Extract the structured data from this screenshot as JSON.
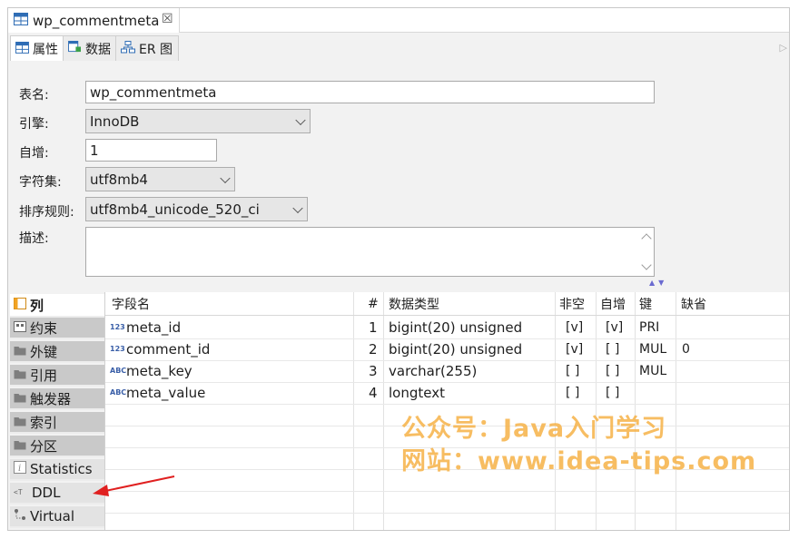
{
  "editor_tab": {
    "title": "wp_commentmeta",
    "close": "☒"
  },
  "sub_tabs": [
    {
      "label": "属性"
    },
    {
      "label": "数据"
    },
    {
      "label": "ER 图"
    }
  ],
  "properties": {
    "table_name_label": "表名:",
    "table_name_value": "wp_commentmeta",
    "engine_label": "引擎:",
    "engine_value": "InnoDB",
    "auto_inc_label": "自增:",
    "auto_inc_value": "1",
    "charset_label": "字符集:",
    "charset_value": "utf8mb4",
    "collation_label": "排序规则:",
    "collation_value": "utf8mb4_unicode_520_ci",
    "desc_label": "描述:",
    "desc_value": ""
  },
  "side_tabs": [
    {
      "label": "列",
      "icon": "columns-icon"
    },
    {
      "label": "约束",
      "icon": "constraint-icon"
    },
    {
      "label": "外键",
      "icon": "folder-icon"
    },
    {
      "label": "引用",
      "icon": "folder-icon"
    },
    {
      "label": "触发器",
      "icon": "folder-icon"
    },
    {
      "label": "索引",
      "icon": "folder-icon"
    },
    {
      "label": "分区",
      "icon": "folder-icon"
    },
    {
      "label": "Statistics",
      "icon": "info-icon"
    },
    {
      "label": "DDL",
      "icon": "ddl-icon"
    },
    {
      "label": "Virtual",
      "icon": "virtual-icon"
    }
  ],
  "columns_table": {
    "headers": [
      "字段名",
      "#",
      "数据类型",
      "非空",
      "自增",
      "键",
      "缺省"
    ],
    "rows": [
      {
        "type_icon": "123",
        "name": "meta_id",
        "num": "1",
        "datatype": "bigint(20) unsigned",
        "notnull": "[v]",
        "autoinc": "[v]",
        "key": "PRI",
        "default": ""
      },
      {
        "type_icon": "123",
        "name": "comment_id",
        "num": "2",
        "datatype": "bigint(20) unsigned",
        "notnull": "[v]",
        "autoinc": "[ ]",
        "key": "MUL",
        "default": "0"
      },
      {
        "type_icon": "ABC",
        "name": "meta_key",
        "num": "3",
        "datatype": "varchar(255)",
        "notnull": "[ ]",
        "autoinc": "[ ]",
        "key": "MUL",
        "default": ""
      },
      {
        "type_icon": "ABC",
        "name": "meta_value",
        "num": "4",
        "datatype": "longtext",
        "notnull": "[ ]",
        "autoinc": "[ ]",
        "key": "",
        "default": ""
      }
    ]
  },
  "watermark": {
    "line1": "公众号：Java入门学习",
    "line2": "网站：www.idea-tips.com"
  },
  "colors": {
    "annotation_arrow": "#e02020",
    "watermark": "#f6b146"
  }
}
